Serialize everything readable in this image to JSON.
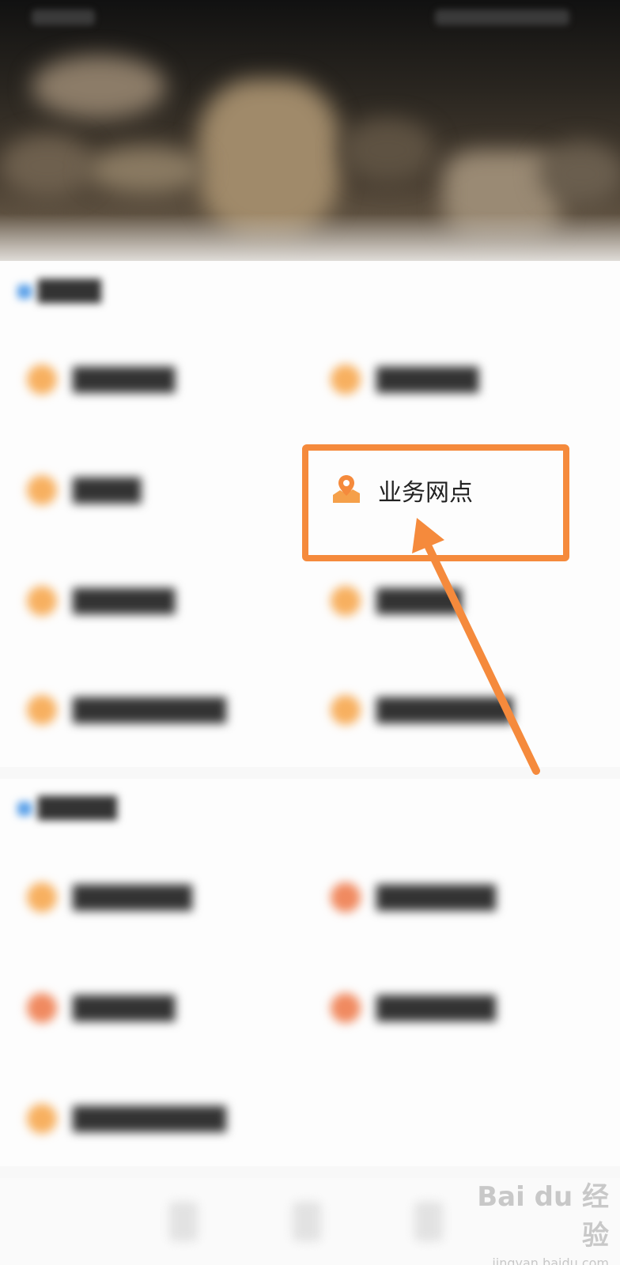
{
  "colors": {
    "accent_orange": "#f58a3c",
    "icon_orange": "#f5a04a",
    "icon_red": "#f08a60",
    "section_mark_blue": "#5aa0e8"
  },
  "sections": [
    {
      "title": "",
      "items": [
        {
          "label": "",
          "icon": "service-dot-icon",
          "color": "orange"
        },
        {
          "label": "",
          "icon": "service-dot-icon",
          "color": "orange"
        },
        {
          "label": "",
          "icon": "service-dot-icon",
          "color": "orange"
        },
        {
          "label": "业务网点",
          "icon": "map-location-icon",
          "color": "orange"
        },
        {
          "label": "",
          "icon": "service-dot-icon",
          "color": "orange"
        },
        {
          "label": "",
          "icon": "service-dot-icon",
          "color": "orange"
        },
        {
          "label": "",
          "icon": "service-dot-icon",
          "color": "orange"
        },
        {
          "label": "",
          "icon": "service-dot-icon",
          "color": "orange"
        }
      ]
    },
    {
      "title": "",
      "items": [
        {
          "label": "",
          "icon": "service-dot-icon",
          "color": "orange"
        },
        {
          "label": "",
          "icon": "service-dot-icon",
          "color": "red"
        },
        {
          "label": "",
          "icon": "service-dot-icon",
          "color": "red"
        },
        {
          "label": "",
          "icon": "service-dot-icon",
          "color": "red"
        },
        {
          "label": "",
          "icon": "service-dot-icon",
          "color": "orange"
        }
      ]
    }
  ],
  "focused_item": {
    "label": "业务网点",
    "icon": "map-location-icon"
  },
  "watermark": {
    "brand": "Bai du 经验",
    "url": "jingyan.baidu.com"
  }
}
